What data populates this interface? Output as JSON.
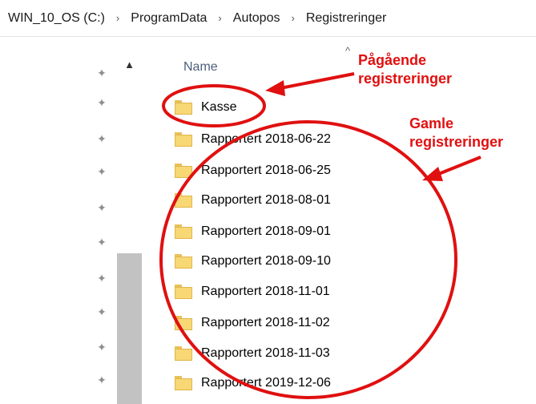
{
  "breadcrumb": {
    "items": [
      "WIN_10_OS (C:)",
      "ProgramData",
      "Autopos",
      "Registreringer"
    ],
    "separator": "›"
  },
  "pane": {
    "column_header": "Name",
    "sort_indicator": "^",
    "scroll_up_icon": "▲"
  },
  "pin_icon": "pushpin-icon",
  "files": [
    {
      "name": "Kasse",
      "icon": "folder-icon"
    },
    {
      "name": "Rapportert 2018-06-22",
      "icon": "folder-icon"
    },
    {
      "name": "Rapportert 2018-06-25",
      "icon": "folder-icon"
    },
    {
      "name": "Rapportert 2018-08-01",
      "icon": "folder-icon"
    },
    {
      "name": "Rapportert 2018-09-01",
      "icon": "folder-icon"
    },
    {
      "name": "Rapportert 2018-09-10",
      "icon": "folder-icon"
    },
    {
      "name": "Rapportert 2018-11-01",
      "icon": "folder-icon"
    },
    {
      "name": "Rapportert 2018-11-02",
      "icon": "folder-icon"
    },
    {
      "name": "Rapportert 2018-11-03",
      "icon": "folder-icon"
    },
    {
      "name": "Rapportert 2019-12-06",
      "icon": "folder-icon"
    }
  ],
  "annotations": {
    "current_label_line1": "Pågående",
    "current_label_line2": "registreringer",
    "old_label_line1": "Gamle",
    "old_label_line2": "registreringer",
    "color": "#e01010"
  }
}
